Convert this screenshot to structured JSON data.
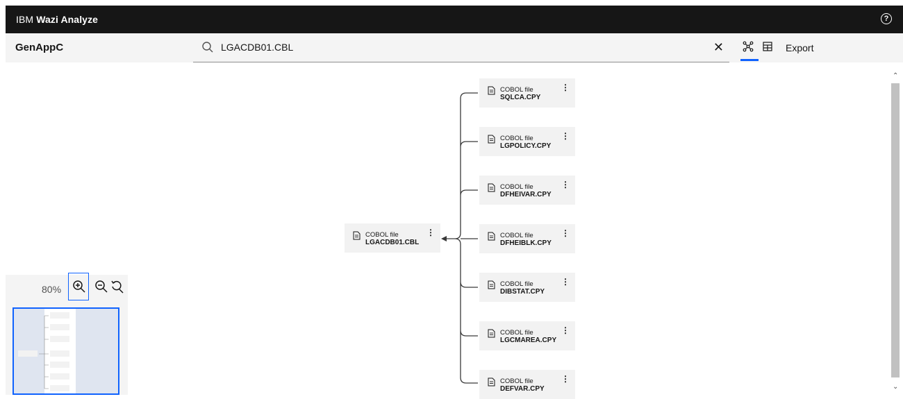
{
  "app": {
    "brand_prefix": "IBM",
    "brand_name": "Wazi Analyze",
    "help_icon": "help-icon"
  },
  "toolbar": {
    "project": "GenAppC",
    "search_value": "LGACDB01.CBL",
    "export_label": "Export",
    "clear_icon": "close-icon",
    "graph_view_icon": "graph-view-icon",
    "table_view_icon": "table-view-icon"
  },
  "graph": {
    "root": {
      "type": "COBOL file",
      "name": "LGACDB01.CBL"
    },
    "dependencies": [
      {
        "type": "COBOL file",
        "name": "SQLCA.CPY"
      },
      {
        "type": "COBOL file",
        "name": "LGPOLICY.CPY"
      },
      {
        "type": "COBOL file",
        "name": "DFHEIVAR.CPY"
      },
      {
        "type": "COBOL file",
        "name": "DFHEIBLK.CPY"
      },
      {
        "type": "COBOL file",
        "name": "DIBSTAT.CPY"
      },
      {
        "type": "COBOL file",
        "name": "LGCMAREA.CPY"
      },
      {
        "type": "COBOL file",
        "name": "DEFVAR.CPY"
      }
    ],
    "menu_glyph": "⋮"
  },
  "zoom": {
    "level": "80%"
  },
  "colors": {
    "header_bg": "#161616",
    "accent": "#0f62fe",
    "node_bg": "#f2f2f2"
  }
}
